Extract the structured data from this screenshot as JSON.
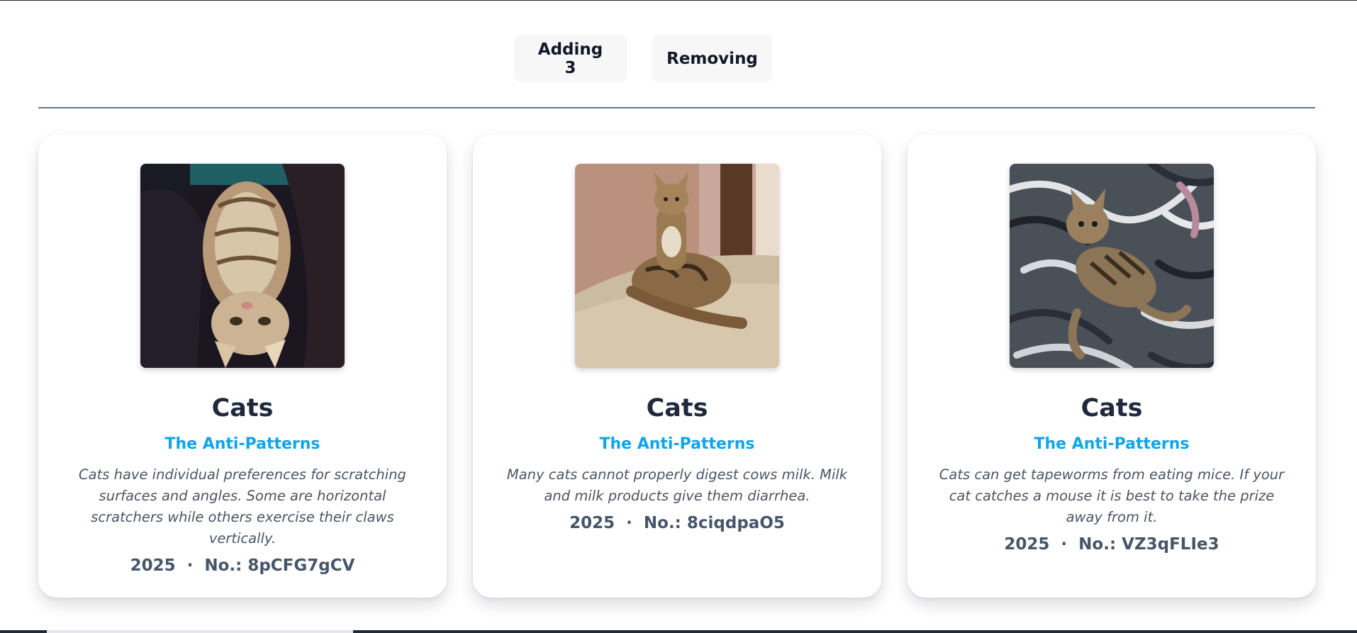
{
  "controls": {
    "add_label": "Adding 3",
    "remove_label": "Removing"
  },
  "cards": [
    {
      "image_icon": "cat-photo-upside-down",
      "title": "Cats",
      "subtitle": "The Anti-Patterns",
      "description": "Cats have individual preferences for scratching surfaces and angles. Some are horizontal scratchers while others exercise their claws vertically.",
      "meta": "2025  ·  No.: 8pCFG7gCV"
    },
    {
      "image_icon": "cat-photo-on-bed",
      "title": "Cats",
      "subtitle": "The Anti-Patterns",
      "description": "Many cats cannot properly digest cows milk. Milk and milk products give them diarrhea.",
      "meta": "2025  ·  No.: 8ciqdpaO5"
    },
    {
      "image_icon": "cat-photo-on-blanket",
      "title": "Cats",
      "subtitle": "The Anti-Patterns",
      "description": "Cats can get tapeworms from eating mice. If your cat catches a mouse it is best to take the prize away from it.",
      "meta": "2025  ·  No.: VZ3qFLIe3"
    }
  ]
}
